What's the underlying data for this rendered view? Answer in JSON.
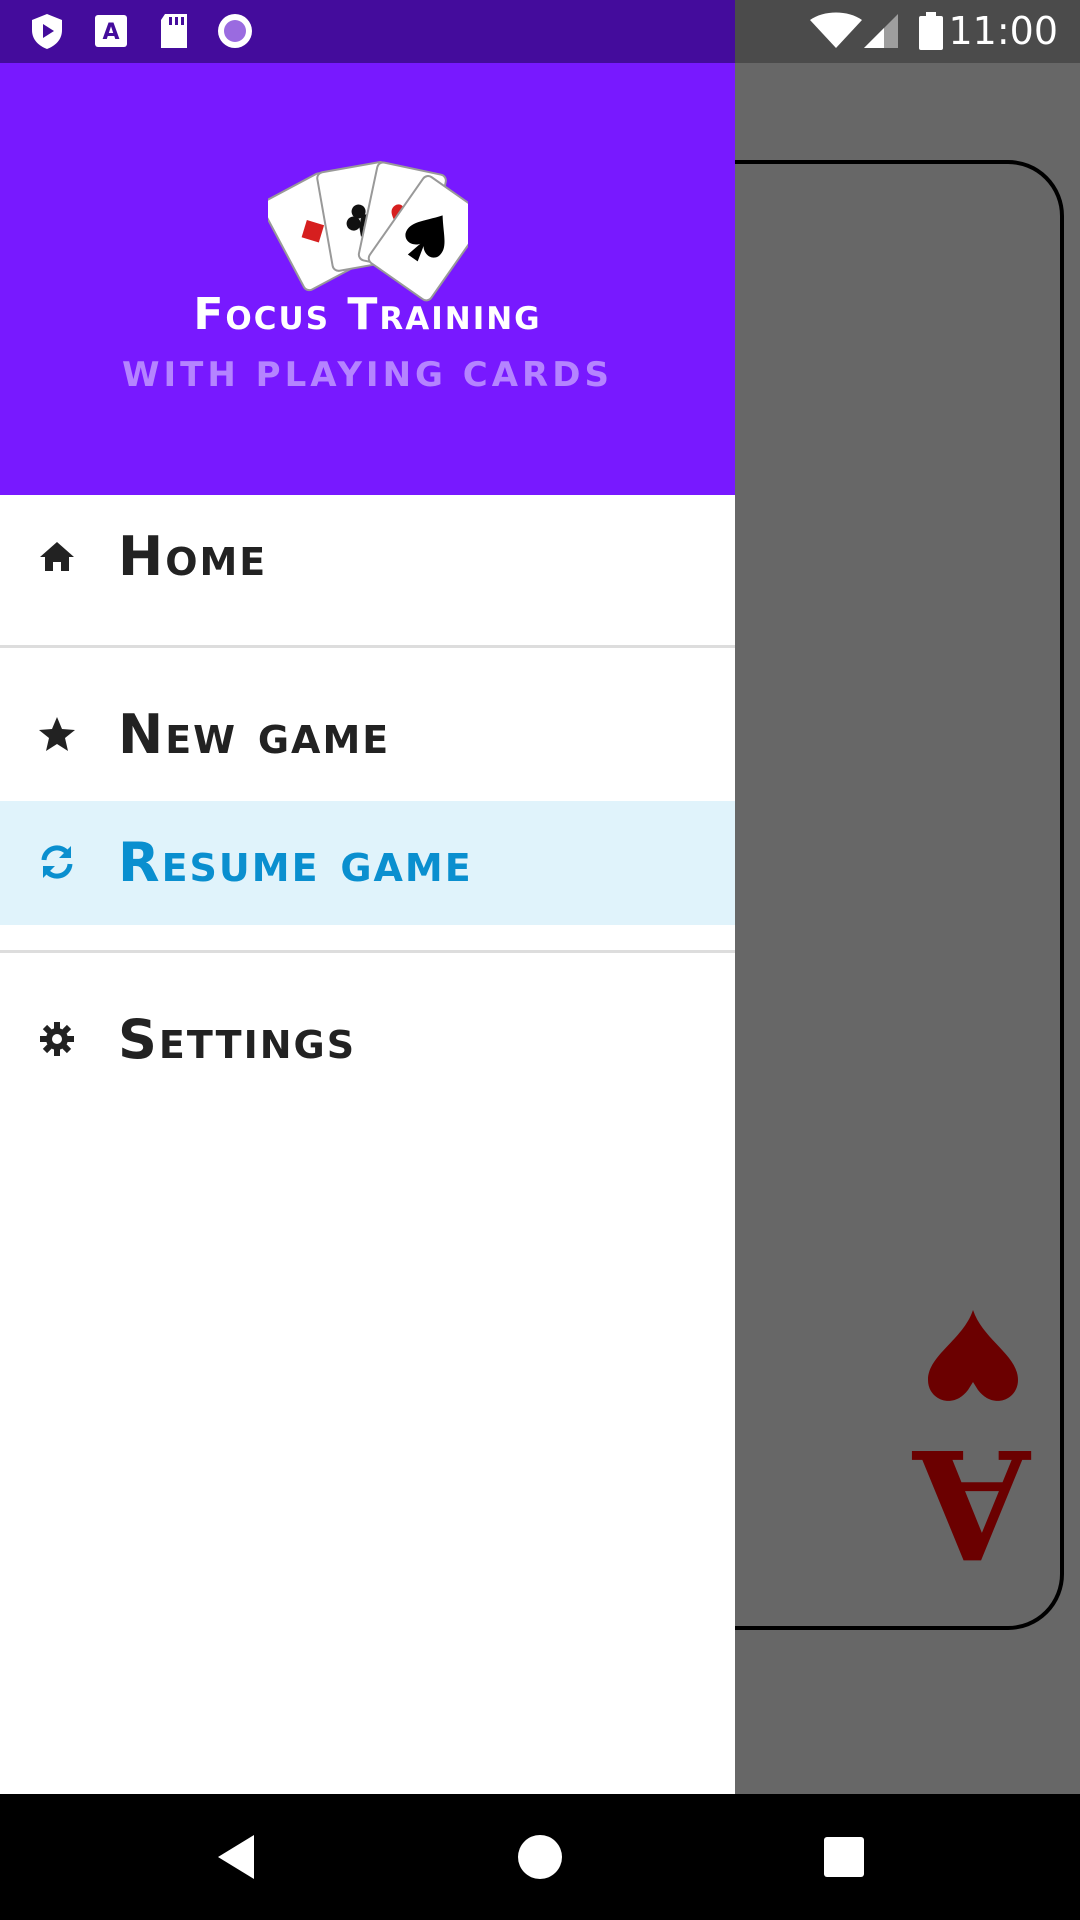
{
  "status_bar": {
    "time": "11:00",
    "left_icons": [
      "shield-play-icon",
      "font-a-icon",
      "sd-card-icon",
      "circle-record-icon"
    ],
    "right_icons": [
      "wifi-icon",
      "signal-icon",
      "battery-icon"
    ]
  },
  "drawer": {
    "header": {
      "title": "Focus Training",
      "subtitle": "with playing cards",
      "logo_icon": "playing-cards-logo",
      "background_color": "#7819ff",
      "subtitle_color": "#b584ff"
    },
    "items": [
      {
        "label": "Home",
        "icon": "home-icon"
      },
      {
        "label": "New game",
        "icon": "star-icon"
      },
      {
        "label": "Resume game",
        "icon": "refresh-icon",
        "active": true
      },
      {
        "label": "Settings",
        "icon": "gear-icon"
      }
    ],
    "active_color": "#0a8fcf",
    "active_background": "#e0f3fb"
  },
  "background_card": {
    "rank": "A",
    "suit": "heart-icon",
    "suit_color": "#6b0000"
  },
  "nav_bar": {
    "buttons": [
      "back-icon",
      "home-circle-icon",
      "recents-icon"
    ]
  }
}
